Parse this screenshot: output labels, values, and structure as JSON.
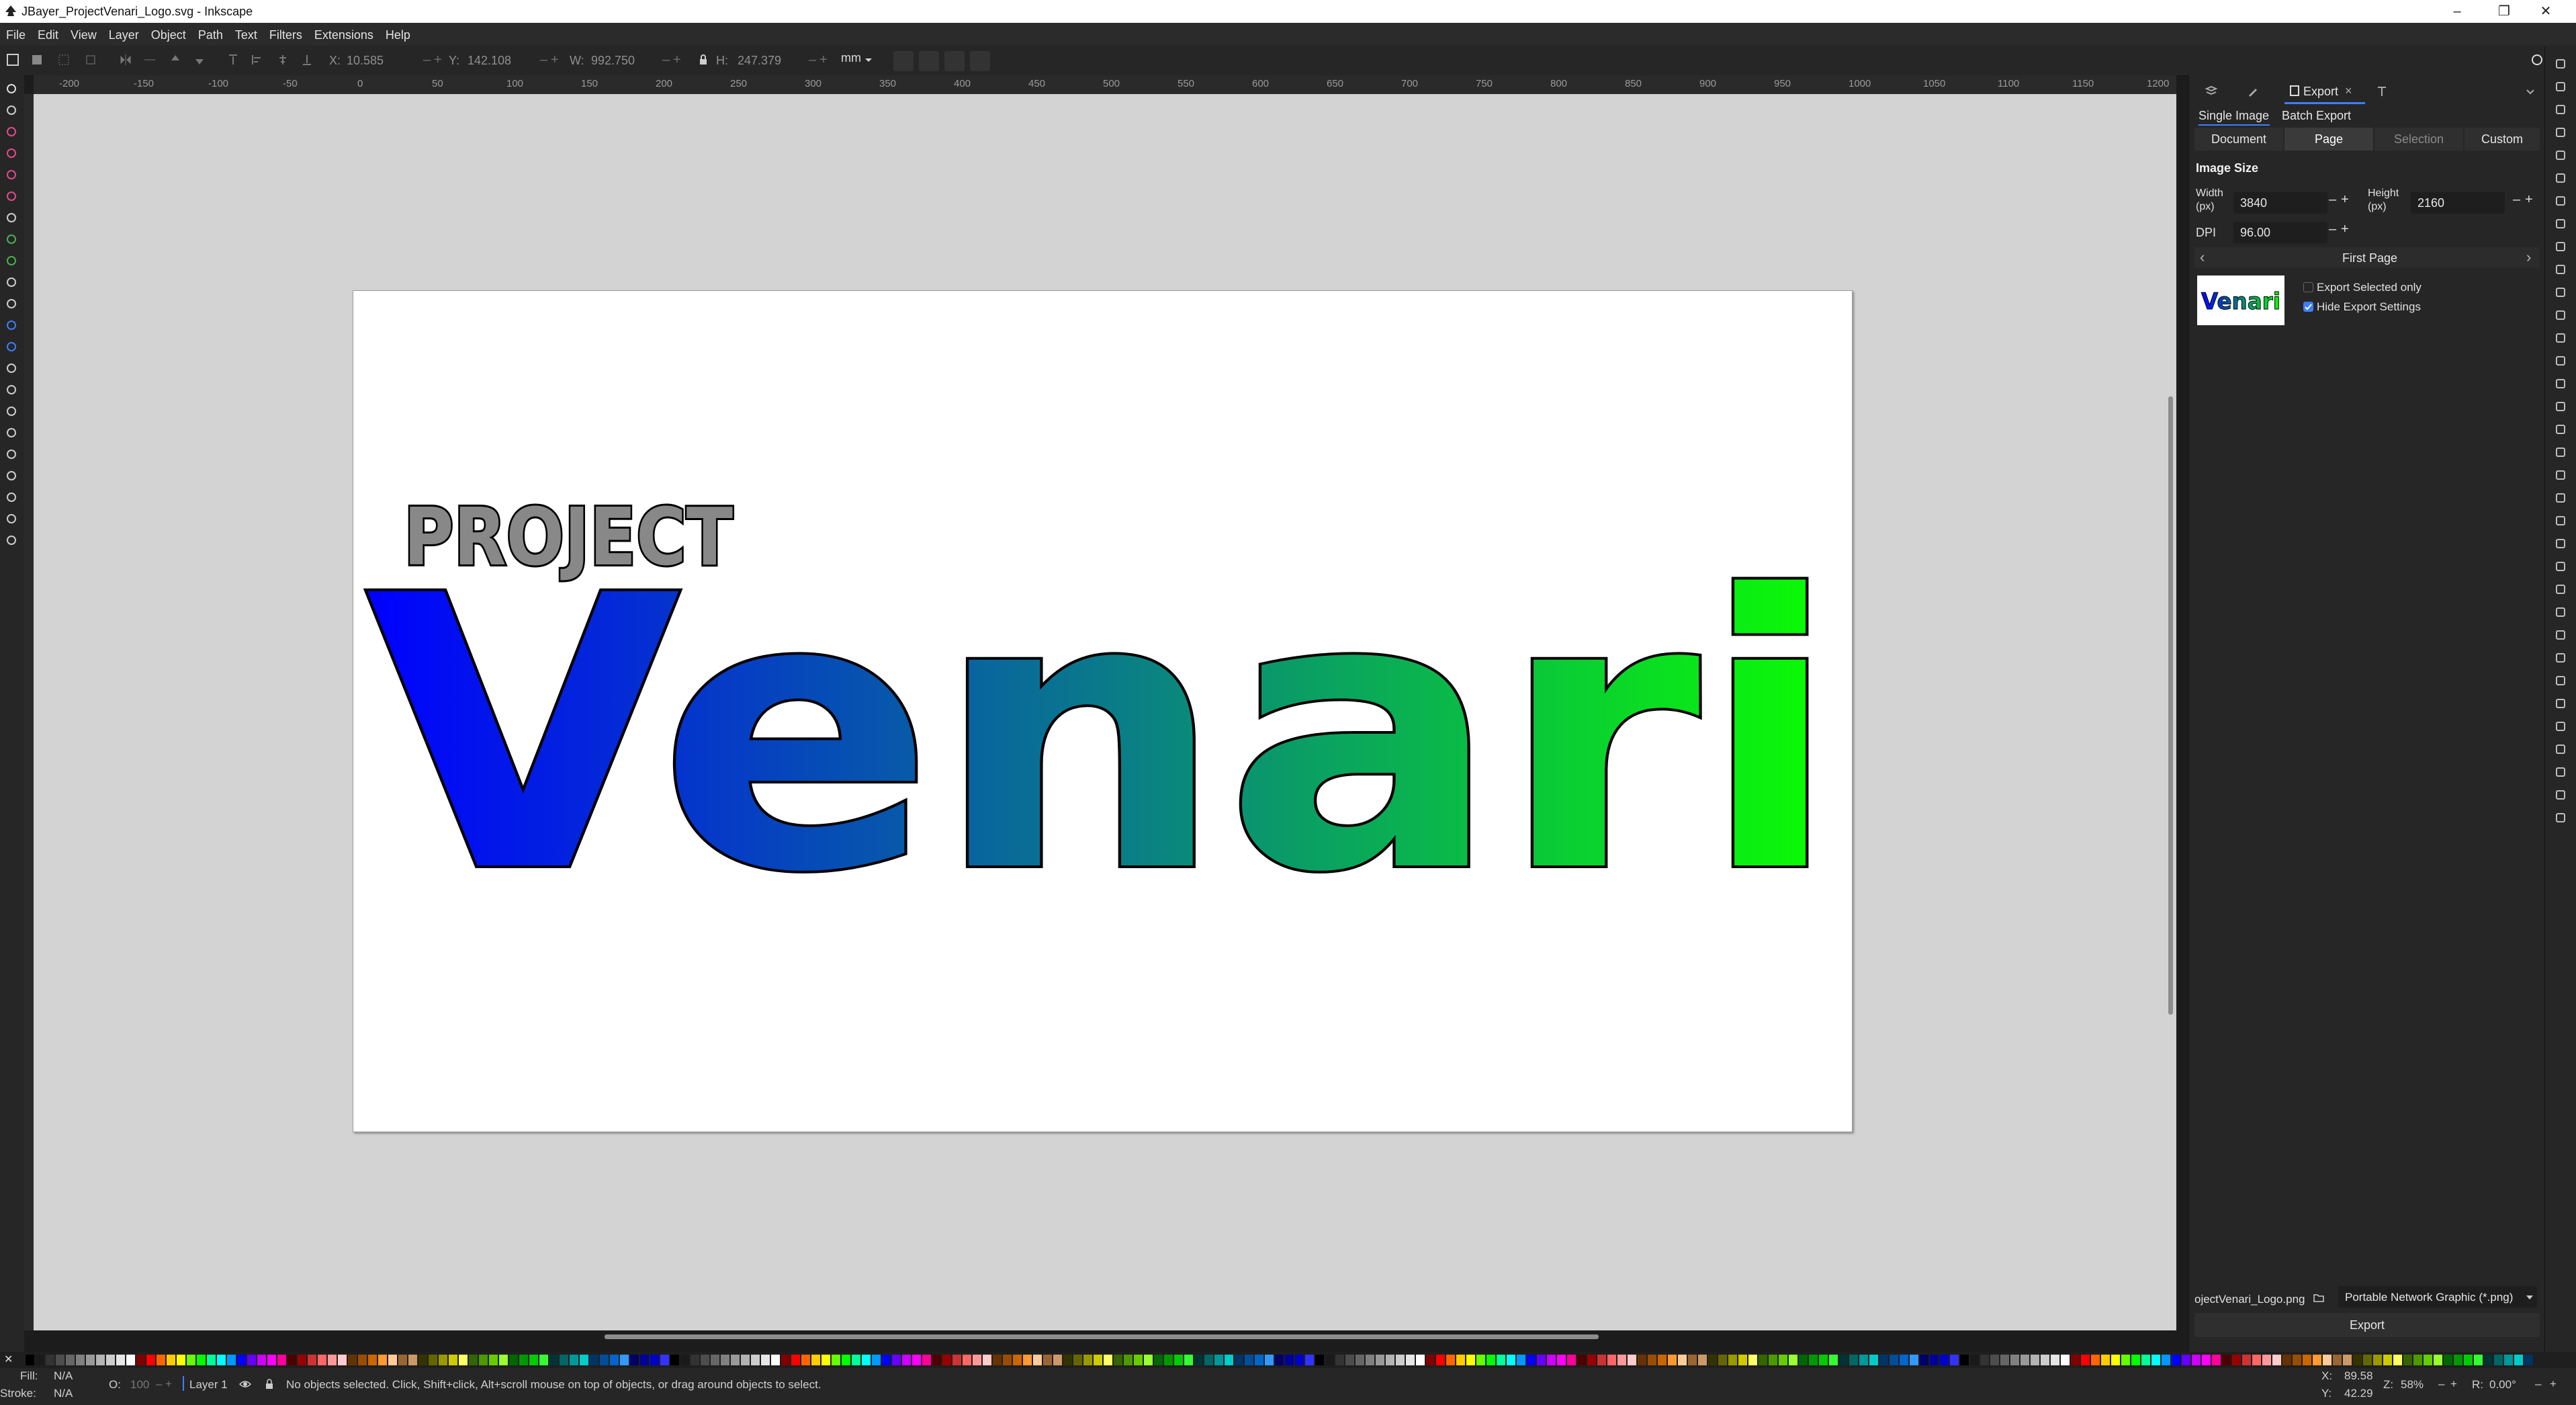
{
  "window": {
    "title": "JBayer_ProjectVenari_Logo.svg - Inkscape",
    "controls": [
      "–",
      "❐",
      "✕"
    ]
  },
  "menu": [
    "File",
    "Edit",
    "View",
    "Layer",
    "Object",
    "Path",
    "Text",
    "Filters",
    "Extensions",
    "Help"
  ],
  "toolbar": {
    "x_label": "X:",
    "x_value": "10.585",
    "y_label": "Y:",
    "y_value": "142.108",
    "w_label": "W:",
    "w_value": "992.750",
    "h_label": "H:",
    "h_value": "247.379",
    "unit": "mm",
    "minus": "–",
    "plus": "+"
  },
  "ruler": {
    "h_ticks": [
      "-200",
      "-150",
      "-100",
      "-50",
      "0",
      "50",
      "100",
      "150",
      "200",
      "250",
      "300",
      "350",
      "400",
      "450",
      "500",
      "550",
      "600",
      "650",
      "700",
      "750",
      "800",
      "850",
      "900",
      "950",
      "1000",
      "1050",
      "1100",
      "1150",
      "1200"
    ]
  },
  "logo": {
    "top_word": "PROJECT",
    "main_word": "Venari",
    "colors": {
      "start": "#0000ff",
      "end": "#0aff00",
      "top_fill": "#888888",
      "stroke": "#000000"
    }
  },
  "export_panel": {
    "tabs": [
      "Export"
    ],
    "close_glyph": "×",
    "mode_tabs": [
      "Single Image",
      "Batch Export"
    ],
    "area_buttons": [
      "Document",
      "Page",
      "Selection",
      "Custom"
    ],
    "active_area": "Page",
    "section_title": "Image Size",
    "width_label": "Width (px)",
    "width_value": "3840",
    "height_label": "Height (px)",
    "height_value": "2160",
    "dpi_label": "DPI",
    "dpi_value": "96.00",
    "page_nav": "First Page",
    "prev": "‹",
    "next": "›",
    "check_selected": "Export Selected only",
    "check_hide": "Hide Export Settings",
    "thumb_text": "Venari",
    "filename": "ojectVenari_Logo.png",
    "format": "Portable Network Graphic (*.png)",
    "export_button": "Export"
  },
  "status": {
    "fill_label": "Fill:",
    "fill_value": "N/A",
    "stroke_label": "Stroke:",
    "stroke_value": "N/A",
    "opacity_label": "O:",
    "opacity_value": "100",
    "layer": "Layer 1",
    "message": "No objects selected. Click, Shift+click, Alt+scroll mouse on top of objects, or drag around objects to select.",
    "x_label": "X:",
    "x_value": "89.58",
    "y_label": "Y:",
    "y_value": "42.29",
    "zoom_label": "Z:",
    "zoom_value": "58%",
    "rot_label": "R:",
    "rot_value": "0.00°"
  },
  "accent_color": "#3d7eff"
}
